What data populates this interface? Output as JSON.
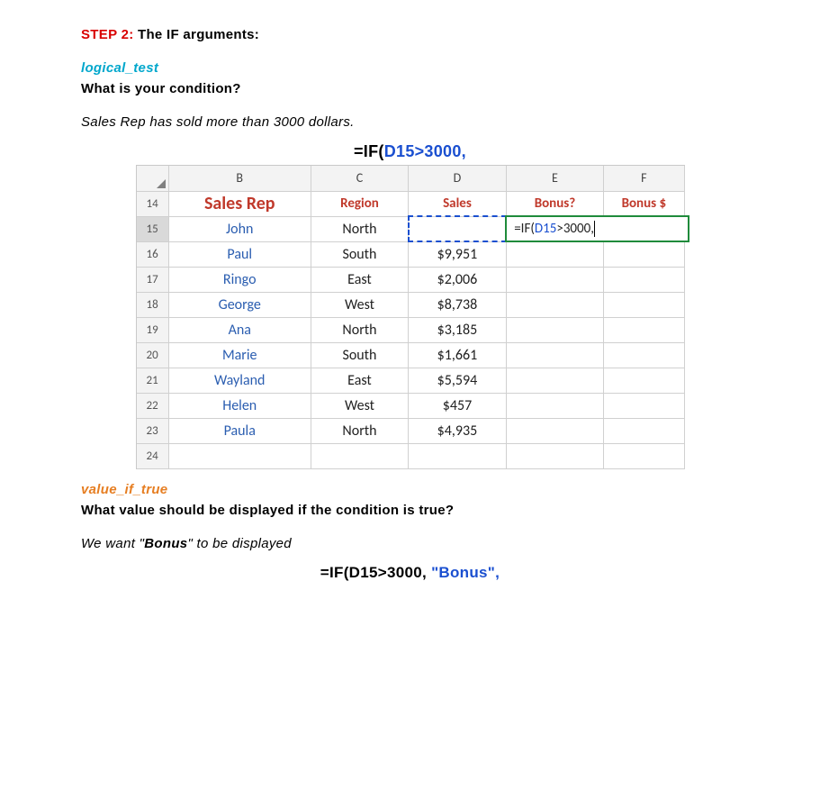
{
  "step": {
    "label": "STEP 2:",
    "rest": " The IF arguments:"
  },
  "arg1": {
    "name": "logical_test",
    "question": "What is your condition?",
    "answer": "Sales Rep has sold more than 3000 dollars."
  },
  "formula1": {
    "prefix": "=IF(",
    "ref": "D15>3000,",
    "suffix": ""
  },
  "sheet": {
    "col_letters": [
      "B",
      "C",
      "D",
      "E",
      "F"
    ],
    "header_row_num": "14",
    "headers": {
      "b": "Sales Rep",
      "c": "Region",
      "d": "Sales",
      "e": "Bonus?",
      "f": "Bonus $"
    },
    "active_row_num": "15",
    "active_formula": {
      "pre": "=IF(",
      "ref": "D15",
      "post": ">3000,"
    },
    "rows": [
      {
        "num": "15",
        "name": "John",
        "region": "North",
        "sales": ""
      },
      {
        "num": "16",
        "name": "Paul",
        "region": "South",
        "sales": "$9,951"
      },
      {
        "num": "17",
        "name": "Ringo",
        "region": "East",
        "sales": "$2,006"
      },
      {
        "num": "18",
        "name": "George",
        "region": "West",
        "sales": "$8,738"
      },
      {
        "num": "19",
        "name": "Ana",
        "region": "North",
        "sales": "$3,185"
      },
      {
        "num": "20",
        "name": "Marie",
        "region": "South",
        "sales": "$1,661"
      },
      {
        "num": "21",
        "name": "Wayland",
        "region": "East",
        "sales": "$5,594"
      },
      {
        "num": "22",
        "name": "Helen",
        "region": "West",
        "sales": "$457"
      },
      {
        "num": "23",
        "name": "Paula",
        "region": "North",
        "sales": "$4,935"
      }
    ],
    "trailing_row_num": "24"
  },
  "arg2": {
    "name": "value_if_true",
    "question": "What value should be displayed if the condition is true?",
    "answer_pre": "We want \"",
    "answer_bold": "Bonus",
    "answer_post": "\" to be displayed"
  },
  "formula2": {
    "black": "=IF(D15>3000, ",
    "blue": "\"Bonus\","
  }
}
